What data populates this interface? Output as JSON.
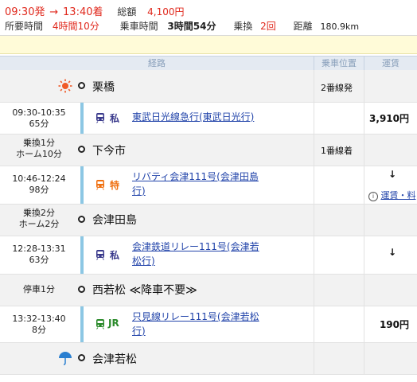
{
  "summary": {
    "dep_time": "09:30発",
    "arrow": "→",
    "arr_time": "13:40着",
    "total_label": "総額",
    "total_value": "4,100円",
    "duration_label": "所要時間",
    "duration_value": "4時間10分",
    "ride_label": "乗車時間",
    "ride_value": "3時間54分",
    "transfer_label": "乗換",
    "transfer_value": "2回",
    "distance_label": "距離",
    "distance_value": "180.9km"
  },
  "table_header": {
    "route": "経路",
    "platform": "乗車位置",
    "fare": "運賃"
  },
  "stations": [
    {
      "name": "栗橋",
      "platform": "2番線発",
      "left_text": "",
      "icon": "sun-icon"
    },
    {
      "name": "下今市",
      "platform": "1番線着",
      "left_text": "乗換1分\nホーム10分"
    },
    {
      "name": "会津田島",
      "platform": "",
      "left_text": "乗換2分\nホーム2分"
    },
    {
      "name": "西若松 ≪降車不要≫",
      "platform": "",
      "left_text": "停車1分"
    },
    {
      "name": "会津若松",
      "platform": "",
      "left_text": "",
      "icon": "umbrella-icon"
    }
  ],
  "segments": [
    {
      "time": "09:30-10:35",
      "dur": "65分",
      "type": "私",
      "type_color": "#3a3a8c",
      "train": "東武日光線急行(東武日光行)",
      "fare": "3,910円"
    },
    {
      "time": "10:46-12:24",
      "dur": "98分",
      "type": "特",
      "type_color": "#f07010",
      "train": "リバティ会津111号(会津田島行)",
      "fare": "↓",
      "fare_note": "運賃・料"
    },
    {
      "time": "12:28-13:31",
      "dur": "63分",
      "type": "私",
      "type_color": "#3a3a8c",
      "train": "会津鉄道リレー111号(会津若松行)",
      "fare": "↓"
    },
    {
      "time": "13:32-13:40",
      "dur": "8分",
      "type": "JR",
      "type_color": "#2a8a2a",
      "train": "只見線リレー111号(会津若松行)",
      "fare": "190円"
    }
  ]
}
